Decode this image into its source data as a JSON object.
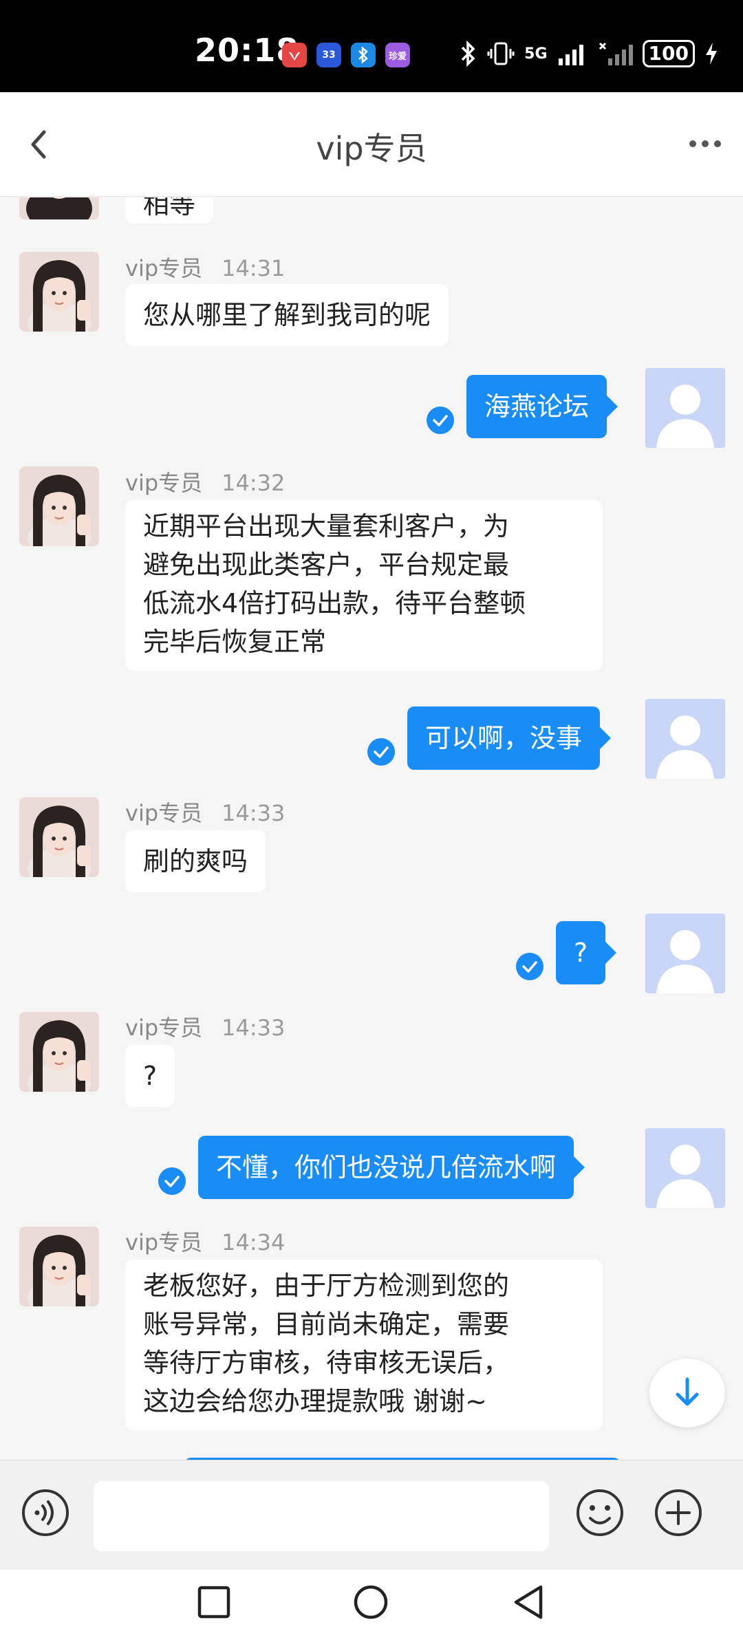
{
  "status": {
    "time": "20:18",
    "apps": [
      {
        "name": "huawei-app-icon",
        "label": "",
        "color": "#e64545"
      },
      {
        "name": "app-33-icon",
        "label": "33",
        "color": "#2b58d9"
      },
      {
        "name": "bluetooth-app-icon",
        "label": "",
        "color": "#1e88e5"
      },
      {
        "name": "app-purple-icon",
        "label": "珍爱",
        "color": "#9c5ce0"
      }
    ],
    "network": "5G",
    "battery": "100"
  },
  "header": {
    "title": "vip专员"
  },
  "messages": [
    {
      "type": "in",
      "text": "相等",
      "partial": true
    },
    {
      "type": "in",
      "sender": "vip专员",
      "time": "14:31",
      "lines": [
        "您从哪里了解到我司的呢"
      ]
    },
    {
      "type": "out",
      "text": "海燕论坛"
    },
    {
      "type": "in",
      "sender": "vip专员",
      "time": "14:32",
      "lines": [
        "近期平台出现大量套利客户，为",
        "避免出现此类客户，平台规定最",
        "低流水4倍打码出款，待平台整顿",
        "完毕后恢复正常"
      ]
    },
    {
      "type": "out",
      "text": "可以啊，没事"
    },
    {
      "type": "in",
      "sender": "vip专员",
      "time": "14:33",
      "lines": [
        "刷的爽吗"
      ]
    },
    {
      "type": "out",
      "text": "?"
    },
    {
      "type": "in",
      "sender": "vip专员",
      "time": "14:33",
      "lines": [
        "?"
      ]
    },
    {
      "type": "out",
      "text": "不懂，你们也没说几倍流水啊"
    },
    {
      "type": "in",
      "sender": "vip专员",
      "time": "14:34",
      "lines": [
        "老板您好，由于厅方检测到您的",
        "账号异常，目前尚未确定，需要",
        "等待厅方审核，待审核无误后，",
        "这边会给您办理提款哦 谢谢~"
      ]
    }
  ],
  "input": {
    "placeholder": ""
  },
  "colors": {
    "accent": "#1a8cf5",
    "background": "#f5f5f5",
    "user_avatar": "#c9d6f8"
  }
}
